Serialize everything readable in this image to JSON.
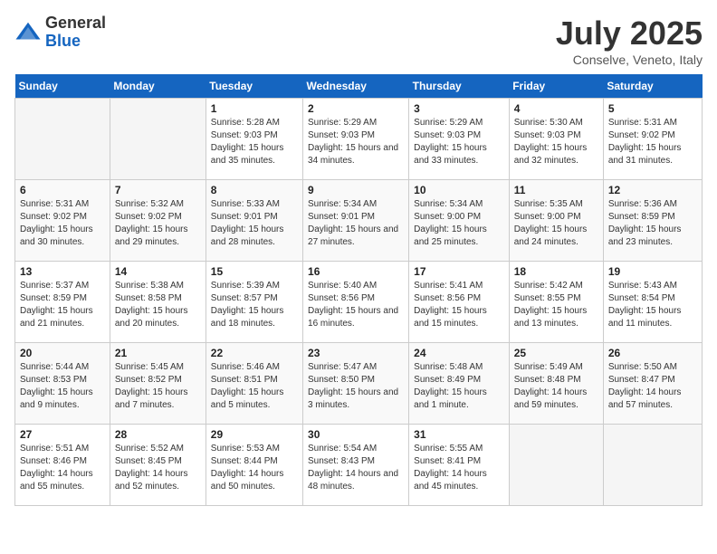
{
  "logo": {
    "general": "General",
    "blue": "Blue"
  },
  "title": "July 2025",
  "subtitle": "Conselve, Veneto, Italy",
  "weekdays": [
    "Sunday",
    "Monday",
    "Tuesday",
    "Wednesday",
    "Thursday",
    "Friday",
    "Saturday"
  ],
  "weeks": [
    [
      {
        "day": "",
        "sunrise": "",
        "sunset": "",
        "daylight": ""
      },
      {
        "day": "",
        "sunrise": "",
        "sunset": "",
        "daylight": ""
      },
      {
        "day": "1",
        "sunrise": "Sunrise: 5:28 AM",
        "sunset": "Sunset: 9:03 PM",
        "daylight": "Daylight: 15 hours and 35 minutes."
      },
      {
        "day": "2",
        "sunrise": "Sunrise: 5:29 AM",
        "sunset": "Sunset: 9:03 PM",
        "daylight": "Daylight: 15 hours and 34 minutes."
      },
      {
        "day": "3",
        "sunrise": "Sunrise: 5:29 AM",
        "sunset": "Sunset: 9:03 PM",
        "daylight": "Daylight: 15 hours and 33 minutes."
      },
      {
        "day": "4",
        "sunrise": "Sunrise: 5:30 AM",
        "sunset": "Sunset: 9:03 PM",
        "daylight": "Daylight: 15 hours and 32 minutes."
      },
      {
        "day": "5",
        "sunrise": "Sunrise: 5:31 AM",
        "sunset": "Sunset: 9:02 PM",
        "daylight": "Daylight: 15 hours and 31 minutes."
      }
    ],
    [
      {
        "day": "6",
        "sunrise": "Sunrise: 5:31 AM",
        "sunset": "Sunset: 9:02 PM",
        "daylight": "Daylight: 15 hours and 30 minutes."
      },
      {
        "day": "7",
        "sunrise": "Sunrise: 5:32 AM",
        "sunset": "Sunset: 9:02 PM",
        "daylight": "Daylight: 15 hours and 29 minutes."
      },
      {
        "day": "8",
        "sunrise": "Sunrise: 5:33 AM",
        "sunset": "Sunset: 9:01 PM",
        "daylight": "Daylight: 15 hours and 28 minutes."
      },
      {
        "day": "9",
        "sunrise": "Sunrise: 5:34 AM",
        "sunset": "Sunset: 9:01 PM",
        "daylight": "Daylight: 15 hours and 27 minutes."
      },
      {
        "day": "10",
        "sunrise": "Sunrise: 5:34 AM",
        "sunset": "Sunset: 9:00 PM",
        "daylight": "Daylight: 15 hours and 25 minutes."
      },
      {
        "day": "11",
        "sunrise": "Sunrise: 5:35 AM",
        "sunset": "Sunset: 9:00 PM",
        "daylight": "Daylight: 15 hours and 24 minutes."
      },
      {
        "day": "12",
        "sunrise": "Sunrise: 5:36 AM",
        "sunset": "Sunset: 8:59 PM",
        "daylight": "Daylight: 15 hours and 23 minutes."
      }
    ],
    [
      {
        "day": "13",
        "sunrise": "Sunrise: 5:37 AM",
        "sunset": "Sunset: 8:59 PM",
        "daylight": "Daylight: 15 hours and 21 minutes."
      },
      {
        "day": "14",
        "sunrise": "Sunrise: 5:38 AM",
        "sunset": "Sunset: 8:58 PM",
        "daylight": "Daylight: 15 hours and 20 minutes."
      },
      {
        "day": "15",
        "sunrise": "Sunrise: 5:39 AM",
        "sunset": "Sunset: 8:57 PM",
        "daylight": "Daylight: 15 hours and 18 minutes."
      },
      {
        "day": "16",
        "sunrise": "Sunrise: 5:40 AM",
        "sunset": "Sunset: 8:56 PM",
        "daylight": "Daylight: 15 hours and 16 minutes."
      },
      {
        "day": "17",
        "sunrise": "Sunrise: 5:41 AM",
        "sunset": "Sunset: 8:56 PM",
        "daylight": "Daylight: 15 hours and 15 minutes."
      },
      {
        "day": "18",
        "sunrise": "Sunrise: 5:42 AM",
        "sunset": "Sunset: 8:55 PM",
        "daylight": "Daylight: 15 hours and 13 minutes."
      },
      {
        "day": "19",
        "sunrise": "Sunrise: 5:43 AM",
        "sunset": "Sunset: 8:54 PM",
        "daylight": "Daylight: 15 hours and 11 minutes."
      }
    ],
    [
      {
        "day": "20",
        "sunrise": "Sunrise: 5:44 AM",
        "sunset": "Sunset: 8:53 PM",
        "daylight": "Daylight: 15 hours and 9 minutes."
      },
      {
        "day": "21",
        "sunrise": "Sunrise: 5:45 AM",
        "sunset": "Sunset: 8:52 PM",
        "daylight": "Daylight: 15 hours and 7 minutes."
      },
      {
        "day": "22",
        "sunrise": "Sunrise: 5:46 AM",
        "sunset": "Sunset: 8:51 PM",
        "daylight": "Daylight: 15 hours and 5 minutes."
      },
      {
        "day": "23",
        "sunrise": "Sunrise: 5:47 AM",
        "sunset": "Sunset: 8:50 PM",
        "daylight": "Daylight: 15 hours and 3 minutes."
      },
      {
        "day": "24",
        "sunrise": "Sunrise: 5:48 AM",
        "sunset": "Sunset: 8:49 PM",
        "daylight": "Daylight: 15 hours and 1 minute."
      },
      {
        "day": "25",
        "sunrise": "Sunrise: 5:49 AM",
        "sunset": "Sunset: 8:48 PM",
        "daylight": "Daylight: 14 hours and 59 minutes."
      },
      {
        "day": "26",
        "sunrise": "Sunrise: 5:50 AM",
        "sunset": "Sunset: 8:47 PM",
        "daylight": "Daylight: 14 hours and 57 minutes."
      }
    ],
    [
      {
        "day": "27",
        "sunrise": "Sunrise: 5:51 AM",
        "sunset": "Sunset: 8:46 PM",
        "daylight": "Daylight: 14 hours and 55 minutes."
      },
      {
        "day": "28",
        "sunrise": "Sunrise: 5:52 AM",
        "sunset": "Sunset: 8:45 PM",
        "daylight": "Daylight: 14 hours and 52 minutes."
      },
      {
        "day": "29",
        "sunrise": "Sunrise: 5:53 AM",
        "sunset": "Sunset: 8:44 PM",
        "daylight": "Daylight: 14 hours and 50 minutes."
      },
      {
        "day": "30",
        "sunrise": "Sunrise: 5:54 AM",
        "sunset": "Sunset: 8:43 PM",
        "daylight": "Daylight: 14 hours and 48 minutes."
      },
      {
        "day": "31",
        "sunrise": "Sunrise: 5:55 AM",
        "sunset": "Sunset: 8:41 PM",
        "daylight": "Daylight: 14 hours and 45 minutes."
      },
      {
        "day": "",
        "sunrise": "",
        "sunset": "",
        "daylight": ""
      },
      {
        "day": "",
        "sunrise": "",
        "sunset": "",
        "daylight": ""
      }
    ]
  ]
}
